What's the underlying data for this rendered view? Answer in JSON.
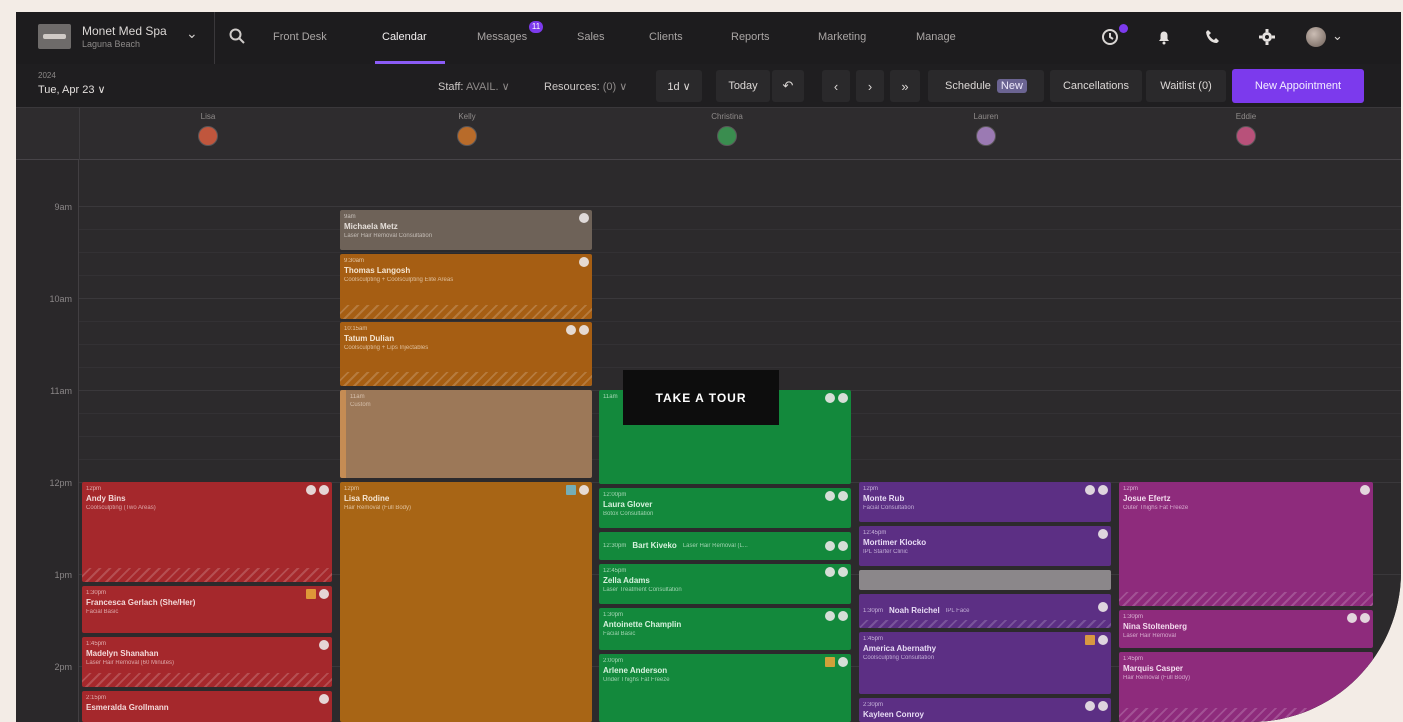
{
  "spa": {
    "name": "Monet Med Spa",
    "location": "Laguna Beach"
  },
  "nav": {
    "tabs": [
      "Front Desk",
      "Calendar",
      "Messages",
      "Sales",
      "Clients",
      "Reports",
      "Marketing",
      "Manage"
    ],
    "messages_badge": "11",
    "active": "Calendar"
  },
  "toolbar": {
    "year": "2024",
    "date": "Tue, Apr 23 ∨",
    "staff_label": "Staff:",
    "staff_value": "AVAIL. ∨",
    "resources_label": "Resources:",
    "resources_value": "(0) ∨",
    "view": "1d ∨",
    "today": "Today",
    "schedule": "Schedule",
    "new_tag": "New",
    "cancellations": "Cancellations",
    "waitlist": "Waitlist (0)",
    "new_appointment": "New Appointment"
  },
  "staff": [
    {
      "name": "Lisa",
      "avatar_color": "#c0563d"
    },
    {
      "name": "Kelly",
      "avatar_color": "#b86b2a"
    },
    {
      "name": "Christina",
      "avatar_color": "#3a8d4f"
    },
    {
      "name": "Lauren",
      "avatar_color": "#9b7ab3"
    },
    {
      "name": "Eddie",
      "avatar_color": "#b8517a"
    }
  ],
  "hours": [
    "9am",
    "10am",
    "11am",
    "12pm",
    "1pm",
    "2pm"
  ],
  "appointments": [
    {
      "time": "9am",
      "name": "Michaela Metz",
      "service": "Laser Hair Removal Consultation",
      "color": "brown"
    },
    {
      "time": "9:30am",
      "name": "Thomas Langosh",
      "service": "Coolsculpting + Coolsculpting Elite Areas",
      "color": "orange"
    },
    {
      "time": "10:15am",
      "name": "Tatum Dulian",
      "service": "Coolsculpting + Lips Injectables",
      "color": "orange"
    },
    {
      "time": "11am",
      "name": "",
      "service": "Custom",
      "color": "tan"
    },
    {
      "time": "12pm",
      "name": "Andy Bins",
      "service": "Coolsculpting (Two Areas)",
      "color": "red"
    },
    {
      "time": "12pm",
      "name": "Lisa Rodine",
      "service": "Hair Removal (Full Body)",
      "color": "orange"
    },
    {
      "time": "1:30pm",
      "name": "Francesca Gerlach (She/Her)",
      "service": "Facial Basic",
      "color": "red"
    },
    {
      "time": "1:45pm",
      "name": "Madelyn Shanahan",
      "service": "Laser Hair Removal (60 Minutes)",
      "color": "red"
    },
    {
      "time": "2:15pm",
      "name": "Esmeralda Grollmann",
      "service": "",
      "color": "red"
    },
    {
      "time": "11am",
      "name": "",
      "service": "",
      "color": "green"
    },
    {
      "time": "12:00pm",
      "name": "Laura Glover",
      "service": "Botox Consultation",
      "color": "green"
    },
    {
      "time": "12:30pm",
      "name": "Bart Kiveko",
      "service": "Laser Hair Removal (L...",
      "color": "green"
    },
    {
      "time": "12:45pm",
      "name": "Zella Adams",
      "service": "Laser Treatment Consultation",
      "color": "green"
    },
    {
      "time": "1:30pm",
      "name": "Antoinette Champlin",
      "service": "Facial Basic",
      "color": "green"
    },
    {
      "time": "2:00pm",
      "name": "Arlene Anderson",
      "service": "Under Thighs Fat Freeze",
      "color": "green"
    },
    {
      "time": "12pm",
      "name": "Monte Rub",
      "service": "Facial Consultation",
      "color": "purple"
    },
    {
      "time": "12:45pm",
      "name": "Mortimer Klocko",
      "service": "IPL Starter Clinic",
      "color": "purple"
    },
    {
      "time": "1:30pm",
      "name": "Noah Reichel",
      "service": "IPL Face",
      "color": "purple"
    },
    {
      "time": "1:45pm",
      "name": "America Abernathy",
      "service": "Coolsculpting Consultation",
      "color": "purple"
    },
    {
      "time": "2:30pm",
      "name": "Kayleen Conroy",
      "service": "",
      "color": "purple"
    },
    {
      "time": "12pm",
      "name": "Josue Efertz",
      "service": "Outer Thighs Fat Freeze",
      "color": "magenta"
    },
    {
      "time": "1:30pm",
      "name": "Nina Stoltenberg",
      "service": "Laser Hair Removal",
      "color": "magenta"
    },
    {
      "time": "1:45pm",
      "name": "Marquis Casper",
      "service": "Hair Removal (Full Body)",
      "color": "magenta"
    }
  ],
  "tour": "TAKE A TOUR"
}
